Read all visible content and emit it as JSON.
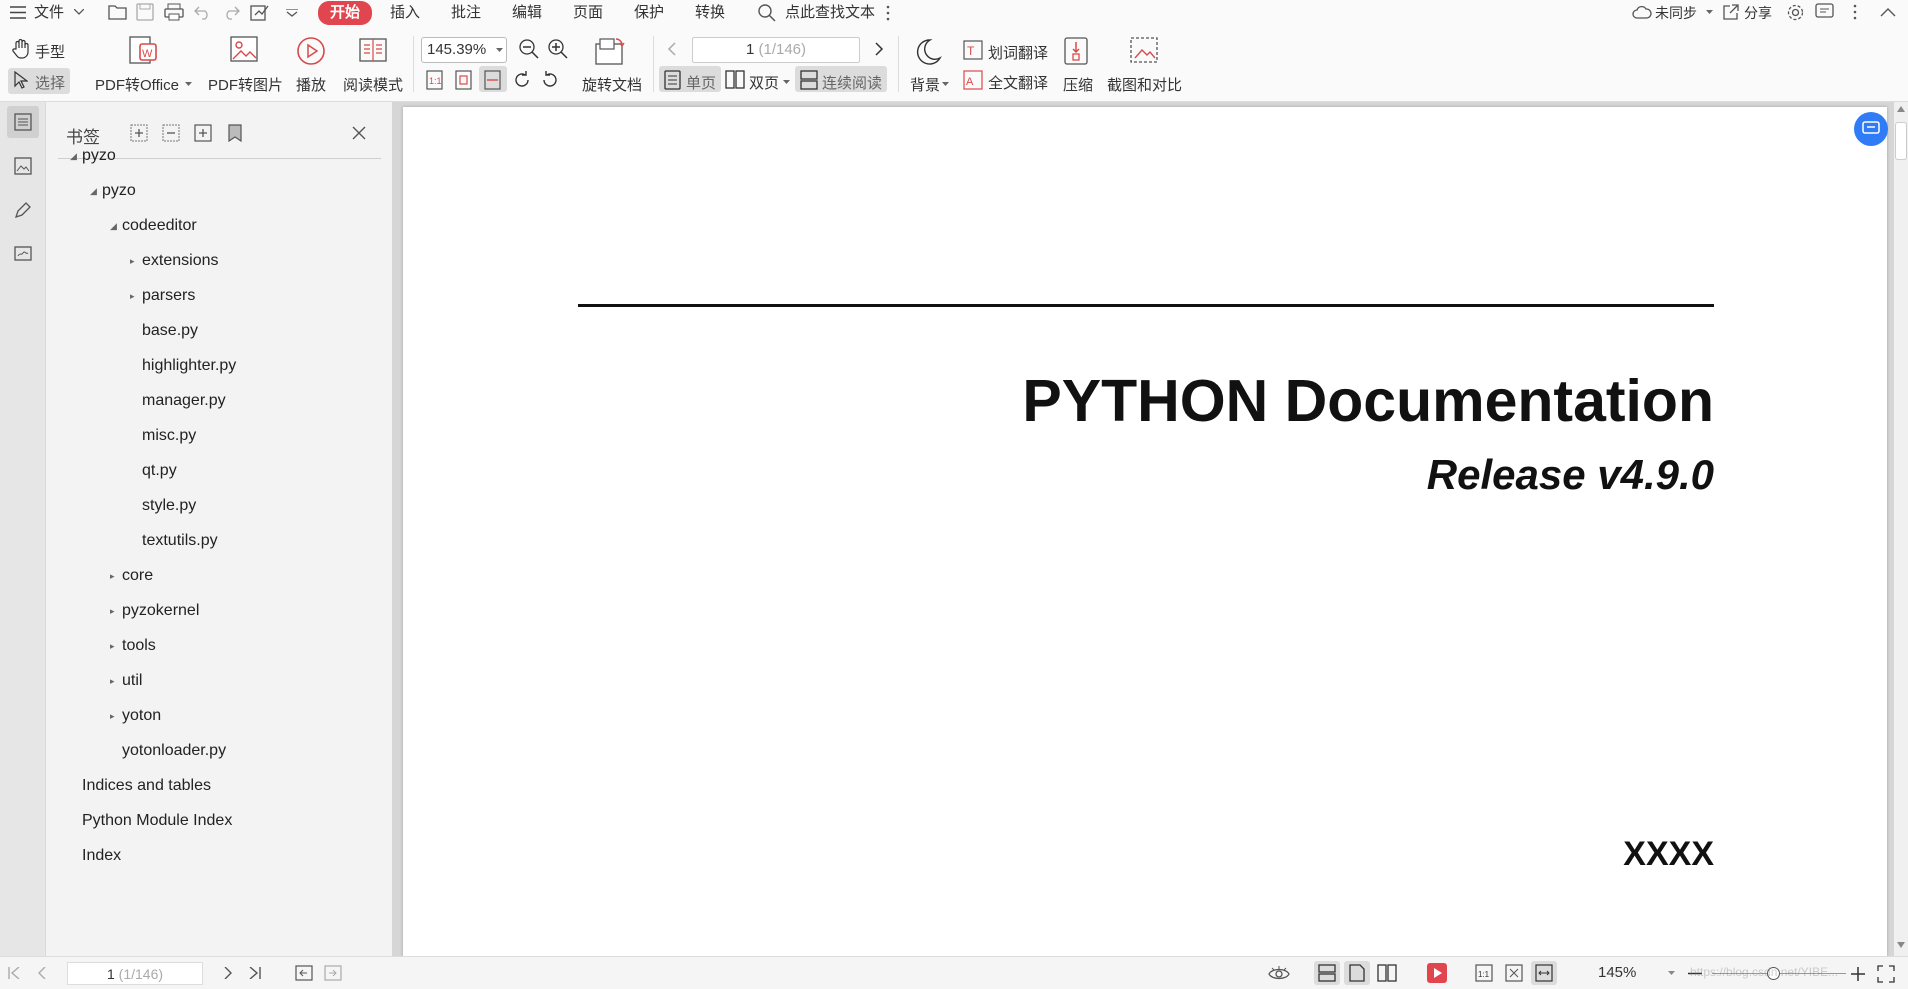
{
  "menubar": {
    "file": "文件",
    "tabs": [
      "开始",
      "插入",
      "批注",
      "编辑",
      "页面",
      "保护",
      "转换"
    ],
    "search": "点此查找文本",
    "sync": "未同步",
    "share": "分享"
  },
  "toolbar": {
    "hand": "手型",
    "select": "选择",
    "pdf_to_office": "PDF转Office",
    "pdf_to_image": "PDF转图片",
    "play": "播放",
    "read_mode": "阅读模式",
    "zoom": "145.39%",
    "rotate_doc": "旋转文档",
    "page_input": "1",
    "page_total": "(1/146)",
    "single": "单页",
    "double": "双页",
    "continuous": "连续阅读",
    "background": "背景",
    "word_translate": "划词翻译",
    "full_translate": "全文翻译",
    "compress": "压缩",
    "screenshot_compare": "截图和对比"
  },
  "panel": {
    "title": "书签",
    "bookmarks": [
      {
        "label": "pyzo",
        "level": 0,
        "toggle": "down"
      },
      {
        "label": "pyzo",
        "level": 1,
        "toggle": "down"
      },
      {
        "label": "codeeditor",
        "level": 2,
        "toggle": "down"
      },
      {
        "label": "extensions",
        "level": 3,
        "toggle": "right"
      },
      {
        "label": "parsers",
        "level": 3,
        "toggle": "right"
      },
      {
        "label": "base.py",
        "level": 3,
        "toggle": "none"
      },
      {
        "label": "highlighter.py",
        "level": 3,
        "toggle": "none"
      },
      {
        "label": "manager.py",
        "level": 3,
        "toggle": "none"
      },
      {
        "label": "misc.py",
        "level": 3,
        "toggle": "none"
      },
      {
        "label": "qt.py",
        "level": 3,
        "toggle": "none"
      },
      {
        "label": "style.py",
        "level": 3,
        "toggle": "none"
      },
      {
        "label": "textutils.py",
        "level": 3,
        "toggle": "none"
      },
      {
        "label": "core",
        "level": 2,
        "toggle": "right"
      },
      {
        "label": "pyzokernel",
        "level": 2,
        "toggle": "right"
      },
      {
        "label": "tools",
        "level": 2,
        "toggle": "right"
      },
      {
        "label": "util",
        "level": 2,
        "toggle": "right"
      },
      {
        "label": "yoton",
        "level": 2,
        "toggle": "right"
      },
      {
        "label": "yotonloader.py",
        "level": 2,
        "toggle": "none"
      },
      {
        "label": "Indices and tables",
        "level": 0,
        "toggle": "none"
      },
      {
        "label": "Python Module Index",
        "level": 0,
        "toggle": "none"
      },
      {
        "label": "Index",
        "level": 0,
        "toggle": "none"
      }
    ]
  },
  "document": {
    "title": "PYTHON Documentation",
    "release": "Release v4.9.0",
    "author": "XXXX"
  },
  "status": {
    "page_input": "1",
    "page_total": "(1/146)",
    "zoom": "145%",
    "watermark": "https://blog.csdn.net/YIBE..."
  }
}
